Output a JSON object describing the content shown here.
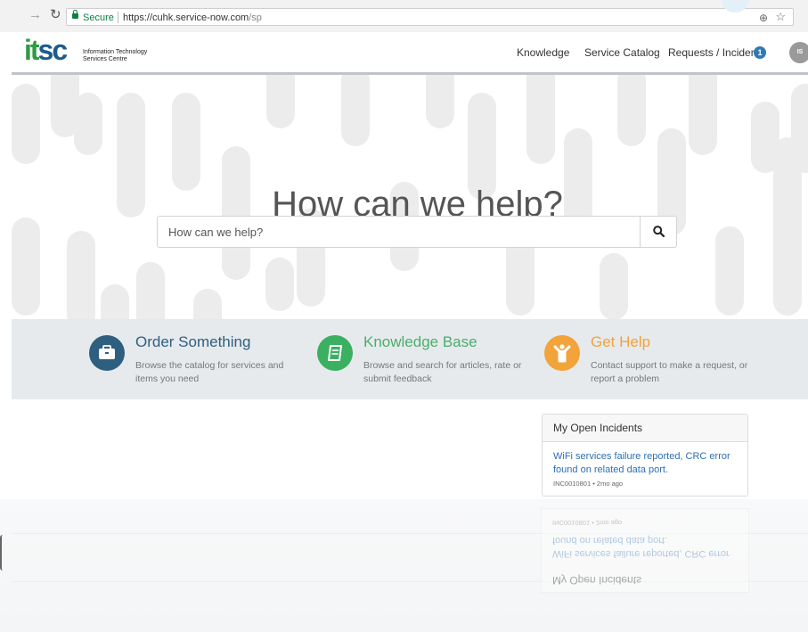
{
  "browser": {
    "secure_label": "Secure",
    "url_host": "https://cuhk.service-now.com",
    "url_path": "/sp",
    "zoom_icon": "zoom-icon",
    "star_icon": "bookmark-star-icon"
  },
  "header": {
    "logo_mark_it": "it",
    "logo_mark_sc": "sc",
    "logo_line1": "Information Technology",
    "logo_line2": "Services Centre",
    "nav": {
      "knowledge": "Knowledge",
      "service_catalog": "Service Catalog",
      "requests_incidents": "Requests / Incidents"
    },
    "requests_badge": "1",
    "avatar_initials": "IS"
  },
  "hero": {
    "title": "How can we help?",
    "search_placeholder": "How can we help?"
  },
  "tiles": [
    {
      "title": "Order Something",
      "description": "Browse the catalog for services and items you need",
      "icon": "briefcase-icon",
      "color": "#2f5f7e",
      "title_color": "#2f5f7e"
    },
    {
      "title": "Knowledge Base",
      "description": "Browse and search for articles, rate or submit feedback",
      "icon": "book-icon",
      "color": "#3bb061",
      "title_color": "#4aae6a"
    },
    {
      "title": "Get Help",
      "description": "Contact support to make a request, or report a problem",
      "icon": "person-icon",
      "color": "#f2a33a",
      "title_color": "#f2a33a"
    }
  ],
  "incidents": {
    "title": "My Open Incidents",
    "items": [
      {
        "text": "WiFi services failure reported, CRC error found on related data port.",
        "meta": "INC0010801 • 2mo ago"
      }
    ]
  }
}
